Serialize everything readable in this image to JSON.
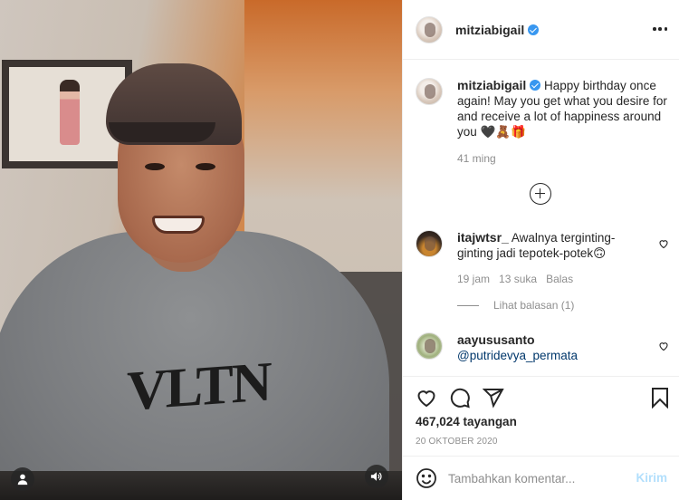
{
  "post": {
    "author": "mitziabigail",
    "caption": "Happy birthday once again! May you get what you desire for and receive a lot of happiness around you 🖤🧸🎁",
    "caption_age": "41 ming",
    "views": "467,024 tayangan",
    "date": "20 OKTOBER 2020"
  },
  "media": {
    "shirt_text": "VLTN"
  },
  "comments": [
    {
      "username": "itajwtsr_",
      "text": "Awalnya terginting-ginting jadi tepotek-potek🙃",
      "age": "19 jam",
      "likes": "13 suka",
      "reply_label": "Balas",
      "view_replies": "Lihat balasan (1)"
    },
    {
      "username": "aayususanto",
      "mention": "@putridevya_permata"
    }
  ],
  "add_comment": {
    "placeholder": "Tambahkan komentar...",
    "post_label": "Kirim"
  },
  "colors": {
    "verified": "#3897f0",
    "link": "#00376b",
    "post_button_disabled": "#b2dffc",
    "secondary_text": "#8e8e8e"
  },
  "icons": [
    "more-icon",
    "verified-icon",
    "add-comments-icon",
    "heart-icon",
    "comment-icon",
    "share-icon",
    "bookmark-icon",
    "emoji-icon",
    "user-tag-icon",
    "speaker-icon"
  ]
}
